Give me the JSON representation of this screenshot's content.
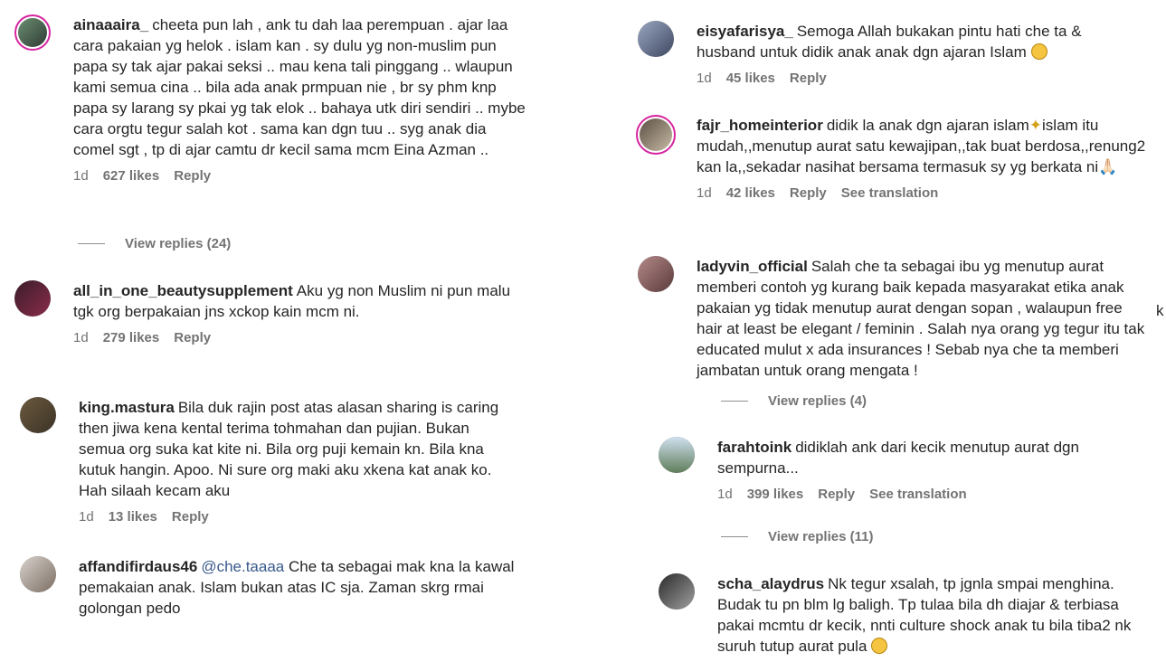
{
  "comments_left": [
    {
      "username": "ainaaaira_",
      "text": "cheeta pun lah , ank tu dah laa perempuan . ajar laa cara pakaian yg helok . islam kan . sy dulu yg non-muslim pun papa sy tak ajar pakai seksi .. mau kena tali pinggang .. wlaupun kami semua cina .. bila ada anak prmpuan nie , br sy phm knp papa sy larang sy pkai yg tak elok .. bahaya utk diri sendiri .. mybe cara orgtu tegur salah kot . sama kan dgn tuu .. syg anak dia comel sgt , tp di ajar camtu dr kecil sama mcm Eina Azman ..",
      "time": "1d",
      "likes": "627 likes",
      "reply": "Reply",
      "view_replies": "View replies (24)"
    },
    {
      "username": "all_in_one_beautysupplement",
      "text": "Aku yg non Muslim ni pun malu tgk org berpakaian jns xckop kain mcm ni.",
      "time": "1d",
      "likes": "279 likes",
      "reply": "Reply"
    },
    {
      "username": "king.mastura",
      "text": "Bila duk rajin post atas alasan sharing is caring then jiwa kena kental terima tohmahan dan pujian. Bukan semua org suka kat kite ni. Bila org puji kemain kn. Bila kna kutuk hangin. Apoo. Ni sure org maki aku xkena kat anak ko. Hah silaah kecam aku",
      "time": "1d",
      "likes": "13 likes",
      "reply": "Reply"
    },
    {
      "username": "affandifirdaus46",
      "mention": "@che.taaaa",
      "text": "Che ta sebagai mak kna la kawal pemakaian anak. Islam bukan atas IC sja. Zaman skrg rmai golongan pedo"
    }
  ],
  "comments_right": [
    {
      "username": "eisyafarisya_",
      "text": "Semoga Allah bukakan pintu hati che ta & husband untuk didik anak anak dgn ajaran Islam",
      "time": "1d",
      "likes": "45 likes",
      "reply": "Reply"
    },
    {
      "username": "fajr_homeinterior",
      "text_a": "didik la anak dgn ajaran islam",
      "text_b": "islam itu mudah,,menutup aurat satu kewajipan,,tak buat berdosa,,renung2 kan la,,sekadar nasihat bersama termasuk sy yg berkata ni",
      "text_c": "🙏🏻",
      "time": "1d",
      "likes": "42 likes",
      "reply": "Reply",
      "translate": "See translation"
    },
    {
      "username": "ladyvin_official",
      "text": "Salah che ta sebagai ibu yg menutup aurat memberi contoh yg kurang baik kepada masyarakat etika anak pakaian yg tidak menutup aurat dengan sopan , walaupun free hair at least be elegant / feminin . Salah nya orang yg tegur itu tak educated mulut x ada insurances ! Sebab nya che ta memberi jambatan untuk orang mengata !",
      "view_replies": "View replies (4)"
    },
    {
      "username": "farahtoink",
      "text": "didiklah ank dari kecik menutup aurat dgn sempurna...",
      "time": "1d",
      "likes": "399 likes",
      "reply": "Reply",
      "translate": "See translation",
      "view_replies": "View replies (11)"
    },
    {
      "username": "scha_alaydrus",
      "text": "Nk tegur xsalah, tp jgnla smpai menghina. Budak tu pn blm lg baligh. Tp tulaa bila dh diajar & terbiasa pakai mcmtu dr kecik, nnti culture shock anak tu bila tiba2 nk suruh tutup aurat pula"
    }
  ],
  "stray_char": "k",
  "colors": {
    "story_ring": "#d6249f",
    "meta_gray": "#737373",
    "mention": "#3a5a8c"
  }
}
